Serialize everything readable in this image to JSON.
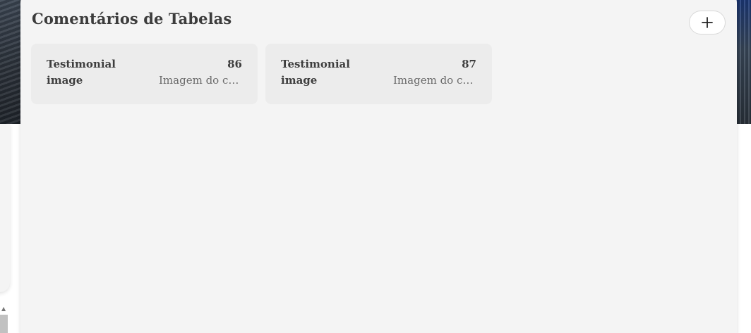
{
  "modal": {
    "title": "Comentários de Tabelas",
    "add_button_icon": "plus-icon"
  },
  "cards": [
    {
      "title": "Testimonial image",
      "id": "86",
      "description": "Imagem do cliente"
    },
    {
      "title": "Testimonial image",
      "id": "87",
      "description": "Imagem do cliente"
    }
  ],
  "background": {
    "scroll_arrow": "▲"
  },
  "colors": {
    "modal_bg": "#f4f4f4",
    "card_bg": "#ececec",
    "title_text": "#3c3c3c",
    "muted_text": "#6a6a6a"
  }
}
